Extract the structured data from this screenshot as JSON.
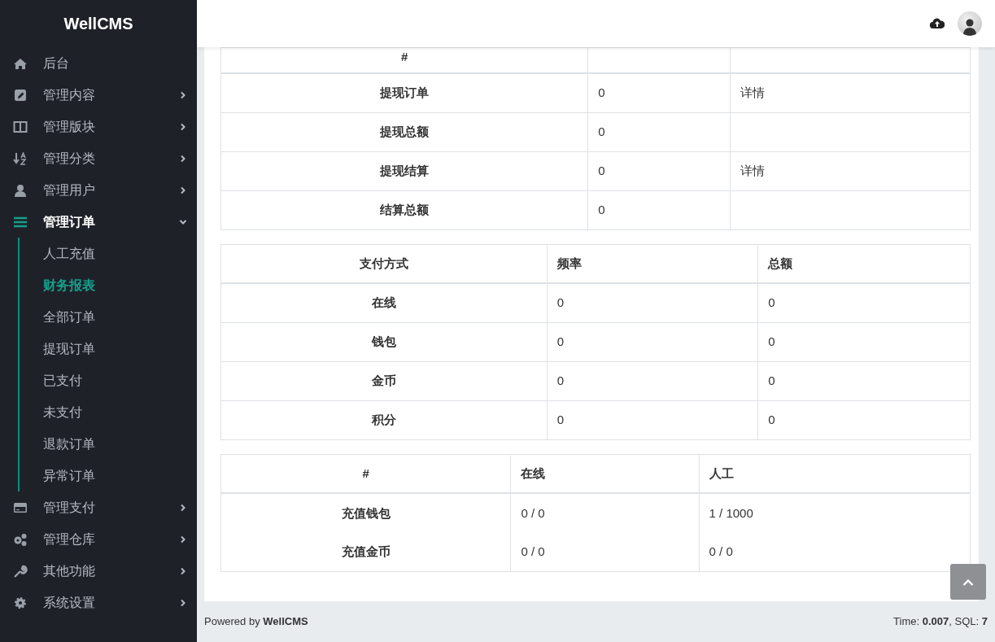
{
  "brand": "WellCMS",
  "sidebar": {
    "items": [
      {
        "label": "后台",
        "kind": "link",
        "selected": false
      },
      {
        "label": "管理内容",
        "kind": "menu",
        "expanded": false,
        "selected": false
      },
      {
        "label": "管理版块",
        "kind": "menu",
        "expanded": false,
        "selected": false
      },
      {
        "label": "管理分类",
        "kind": "menu",
        "expanded": false,
        "selected": false
      },
      {
        "label": "管理用户",
        "kind": "menu",
        "expanded": false,
        "selected": false
      },
      {
        "label": "管理订单",
        "kind": "menu",
        "expanded": true,
        "selected": true,
        "children": [
          {
            "label": "人工充值",
            "selected": false
          },
          {
            "label": "财务报表",
            "selected": true
          },
          {
            "label": "全部订单",
            "selected": false
          },
          {
            "label": "提现订单",
            "selected": false
          },
          {
            "label": "已支付",
            "selected": false
          },
          {
            "label": "未支付",
            "selected": false
          },
          {
            "label": "退款订单",
            "selected": false
          },
          {
            "label": "异常订单",
            "selected": false
          }
        ]
      },
      {
        "label": "管理支付",
        "kind": "menu",
        "expanded": false,
        "selected": false
      },
      {
        "label": "管理仓库",
        "kind": "menu",
        "expanded": false,
        "selected": false
      },
      {
        "label": "其他功能",
        "kind": "menu",
        "expanded": false,
        "selected": false
      },
      {
        "label": "系统设置",
        "kind": "menu",
        "expanded": false,
        "selected": false
      }
    ]
  },
  "tables": [
    {
      "columns": [
        "#"
      ],
      "rows": [
        [
          "提现订单",
          "0",
          "详情"
        ],
        [
          "提现总额",
          "0"
        ],
        [
          "提现结算",
          "0",
          "详情"
        ],
        [
          "结算总额",
          "0"
        ]
      ]
    },
    {
      "columns": [
        "支付方式",
        "频率",
        "总额"
      ],
      "rows": [
        [
          "在线",
          "0",
          "0"
        ],
        [
          "钱包",
          "0",
          "0"
        ],
        [
          "金币",
          "0",
          "0"
        ],
        [
          "积分",
          "0",
          "0"
        ]
      ]
    },
    {
      "columns": [
        "#",
        "在线",
        "人工"
      ],
      "rows": [
        [
          "充值钱包",
          "0 / 0",
          "1 / 1000"
        ],
        [
          "充值金币",
          "0 / 0",
          "0 / 0"
        ]
      ]
    }
  ],
  "footer": {
    "left": "Powered by **WellCMS**",
    "right": "Time: **0.007**, SQL: **7**"
  }
}
